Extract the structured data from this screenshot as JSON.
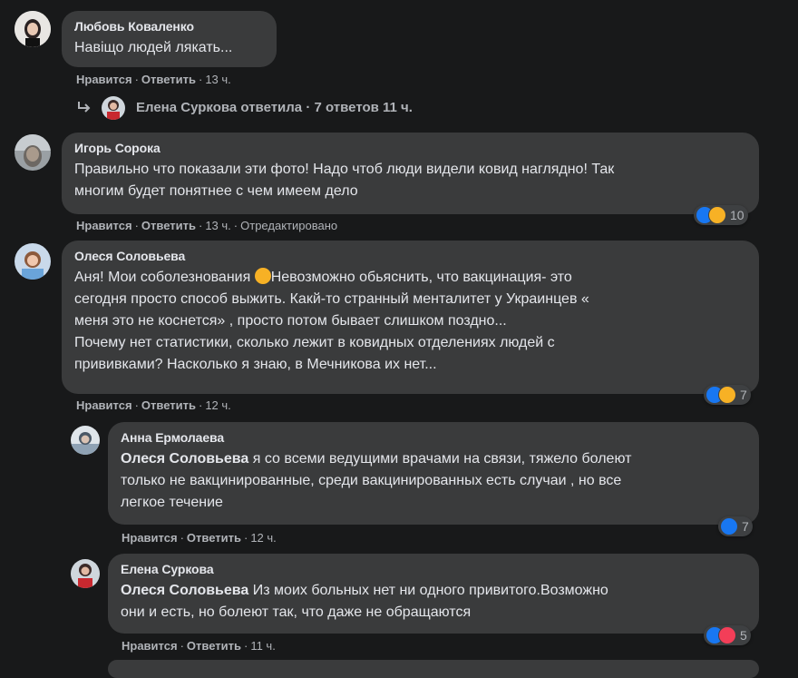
{
  "comments": [
    {
      "author": "Любовь Коваленко",
      "text": "Навіщо людей лякать...",
      "like": "Нравится",
      "reply": "Ответить",
      "time": "13 ч."
    },
    {
      "author": "Игорь Сорока",
      "text": "Правильно что показали эти фото! Надо чтоб люди видели ковид наглядно! Так\nмногим будет понятнее с чем имеем дело",
      "like": "Нравится",
      "reply": "Ответить",
      "time": "13 ч.",
      "edited": "Отредактировано",
      "reaction_count": "10"
    },
    {
      "author": "Олеся Соловьева",
      "text_a": "Аня! Мои соболезнования ",
      "text_b": "Невозможно обьяснить, что вакцинация- это\nсегодня просто способ выжить. Какй-то странный менталитет у Украинцев «\nменя это не коснется» , просто потом бывает слишком поздно...\nПочему нет статистики, сколько лежит в ковидных отделениях людей с\nпрививками? Насколько я знаю, в Мечникова их нет...",
      "like": "Нравится",
      "reply": "Ответить",
      "time": "12 ч.",
      "reaction_count": "7"
    },
    {
      "author": "Анна Ермолаева",
      "mention": "Олеся Соловьева",
      "text": " я со всеми ведущими врачами на связи, тяжело болеют\nтолько не вакцинированные, среди вакцинированных есть случаи , но все\nлегкое течение",
      "like": "Нравится",
      "reply": "Ответить",
      "time": "12 ч.",
      "reaction_count": "7"
    },
    {
      "author": "Елена Суркова",
      "mention": "Олеся Соловьева",
      "text": " Из моих больных нет ни одного привитого.Возможно\nони и есть, но болеют так, что даже не обращаются",
      "like": "Нравится",
      "reply": "Ответить",
      "time": "11 ч.",
      "reaction_count": "5"
    }
  ],
  "replies_summary": {
    "author": "Елена Суркова",
    "action": "ответила",
    "count": "7 ответов",
    "time": "11 ч."
  },
  "separator": "·",
  "colors": {
    "background": "#18191a",
    "bubble": "#3a3b3c",
    "text": "#e4e6eb",
    "muted": "#b0b3b8",
    "like": "#1877f2",
    "haha": "#f7b125",
    "love": "#f33e58"
  }
}
